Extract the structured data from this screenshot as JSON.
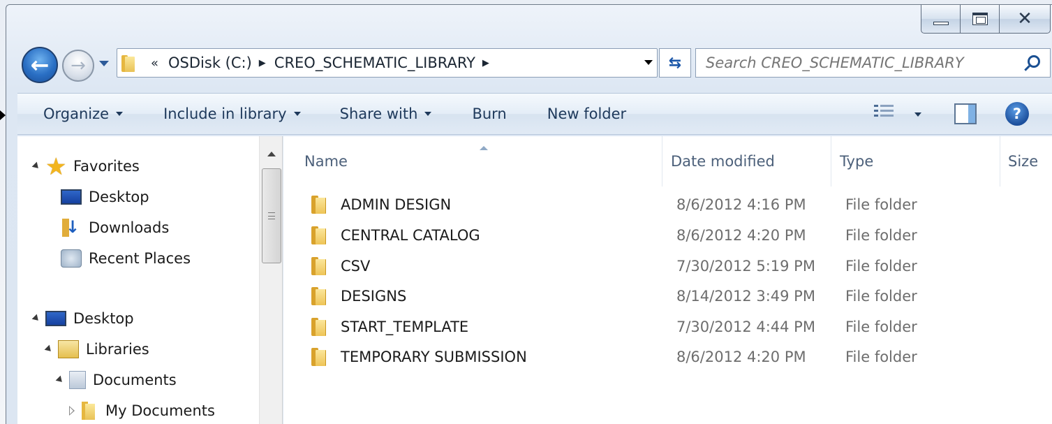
{
  "window": {
    "caption_buttons": {
      "minimize": "minimize",
      "maximize": "maximize",
      "close": "close"
    }
  },
  "nav": {
    "address": {
      "chevron": "«",
      "segments": [
        "OSDisk (C:)",
        "CREO_SCHEMATIC_LIBRARY"
      ]
    },
    "search": {
      "placeholder": "Search CREO_SCHEMATIC_LIBRARY"
    }
  },
  "toolbar": {
    "organize": "Organize",
    "include_in_library": "Include in library",
    "share_with": "Share with",
    "burn": "Burn",
    "new_folder": "New folder",
    "help": "?"
  },
  "sidebar": {
    "items": [
      {
        "label": "Favorites",
        "icon": "star-icon"
      },
      {
        "label": "Desktop",
        "icon": "desktop-icon"
      },
      {
        "label": "Downloads",
        "icon": "downloads-icon"
      },
      {
        "label": "Recent Places",
        "icon": "recent-places-icon"
      },
      {
        "label": "Desktop",
        "icon": "desktop-icon"
      },
      {
        "label": "Libraries",
        "icon": "libraries-icon"
      },
      {
        "label": "Documents",
        "icon": "documents-icon"
      },
      {
        "label": "My Documents",
        "icon": "folder-icon"
      }
    ]
  },
  "file_list": {
    "columns": {
      "name": "Name",
      "date": "Date modified",
      "type": "Type",
      "size": "Size"
    },
    "rows": [
      {
        "name": "ADMIN DESIGN",
        "date": "8/6/2012 4:16 PM",
        "type": "File folder"
      },
      {
        "name": "CENTRAL CATALOG",
        "date": "8/6/2012 4:20 PM",
        "type": "File folder"
      },
      {
        "name": "CSV",
        "date": "7/30/2012 5:19 PM",
        "type": "File folder"
      },
      {
        "name": "DESIGNS",
        "date": "8/14/2012 3:49 PM",
        "type": "File folder"
      },
      {
        "name": "START_TEMPLATE",
        "date": "7/30/2012 4:44 PM",
        "type": "File folder"
      },
      {
        "name": "TEMPORARY SUBMISSION",
        "date": "8/6/2012 4:20 PM",
        "type": "File folder"
      }
    ]
  }
}
